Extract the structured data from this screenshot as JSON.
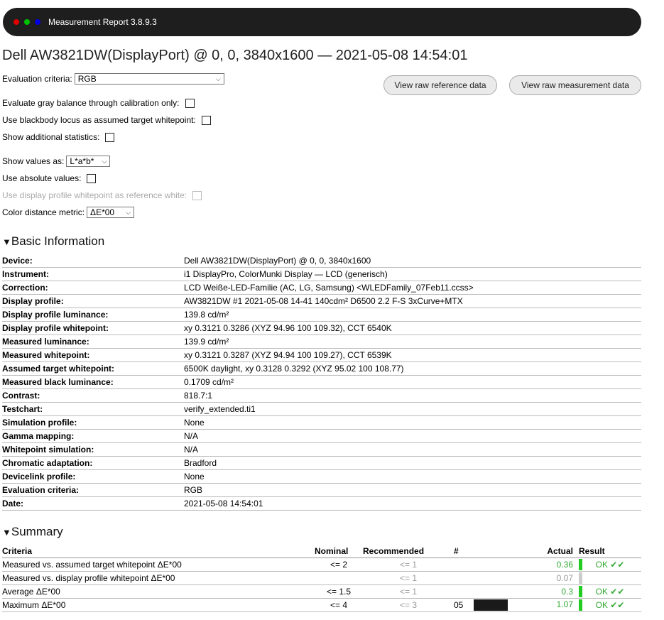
{
  "window": {
    "title": "Measurement Report 3.8.9.3",
    "dots": [
      "#e00000",
      "#00c000",
      "#0000e0"
    ]
  },
  "report_title": "Dell AW3821DW(DisplayPort) @ 0, 0, 3840x1600 — 2021-05-08 14:54:01",
  "controls": {
    "evaluation_criteria_label": "Evaluation criteria:",
    "evaluation_criteria_value": "RGB",
    "view_raw_reference": "View raw reference data",
    "view_raw_measurement": "View raw measurement data",
    "gray_balance_label": "Evaluate gray balance through calibration only:",
    "blackbody_label": "Use blackbody locus as assumed target whitepoint:",
    "additional_stats_label": "Show additional statistics:",
    "show_values_label": "Show values as:",
    "show_values_value": "L*a*b*",
    "absolute_values_label": "Use absolute values:",
    "profile_whitepoint_label": "Use display profile whitepoint as reference white:",
    "distance_metric_label": "Color distance metric:",
    "distance_metric_value": "ΔE*00"
  },
  "basic_info": {
    "heading": "Basic Information",
    "rows": [
      {
        "k": "Device:",
        "v": "Dell AW3821DW(DisplayPort) @ 0, 0, 3840x1600"
      },
      {
        "k": "Instrument:",
        "v": "i1 DisplayPro, ColorMunki Display — LCD (generisch)"
      },
      {
        "k": "Correction:",
        "v": "LCD Weiße-LED-Familie (AC, LG, Samsung) <WLEDFamily_07Feb11.ccss>"
      },
      {
        "k": "Display profile:",
        "v": "AW3821DW #1 2021-05-08 14-41 140cdm² D6500 2.2 F-S 3xCurve+MTX"
      },
      {
        "k": "Display profile luminance:",
        "v": "139.8 cd/m²"
      },
      {
        "k": "Display profile whitepoint:",
        "v": "xy 0.3121 0.3286 (XYZ 94.96 100 109.32), CCT 6540K"
      },
      {
        "k": "Measured luminance:",
        "v": "139.9 cd/m²"
      },
      {
        "k": "Measured whitepoint:",
        "v": "xy 0.3121 0.3287 (XYZ 94.94 100 109.27), CCT 6539K"
      },
      {
        "k": "Assumed target whitepoint:",
        "v": "6500K daylight, xy 0.3128 0.3292 (XYZ 95.02 100 108.77)"
      },
      {
        "k": "Measured black luminance:",
        "v": "0.1709 cd/m²"
      },
      {
        "k": "Contrast:",
        "v": "818.7:1"
      },
      {
        "k": "Testchart:",
        "v": "verify_extended.ti1"
      },
      {
        "k": "Simulation profile:",
        "v": "None"
      },
      {
        "k": "Gamma mapping:",
        "v": "N/A"
      },
      {
        "k": "Whitepoint simulation:",
        "v": "N/A"
      },
      {
        "k": "Chromatic adaptation:",
        "v": "Bradford"
      },
      {
        "k": "Devicelink profile:",
        "v": "None"
      },
      {
        "k": "Evaluation criteria:",
        "v": "RGB"
      },
      {
        "k": "Date:",
        "v": "2021-05-08 14:54:01"
      }
    ]
  },
  "summary": {
    "heading": "Summary",
    "headers": {
      "criteria": "Criteria",
      "nominal": "Nominal",
      "recommended": "Recommended",
      "num": "#",
      "actual": "Actual",
      "result": "Result"
    },
    "rows": [
      {
        "criteria": "Measured vs. assumed target whitepoint ΔE*00",
        "nominal": "<= 2",
        "recommended": "<= 1",
        "num": "",
        "actual": "0.36",
        "result": "OK ✔✔",
        "bar_color": "#22cc22"
      },
      {
        "criteria": "Measured vs. display profile whitepoint ΔE*00",
        "nominal": "",
        "recommended": "<= 1",
        "num": "",
        "actual": "0.07",
        "result": "",
        "bar_color": "#cccccc"
      },
      {
        "criteria": "Average ΔE*00",
        "nominal": "<= 1.5",
        "recommended": "<= 1",
        "num": "",
        "actual": "0.3",
        "result": "OK ✔✔",
        "bar_color": "#22cc22"
      },
      {
        "criteria": "Maximum ΔE*00",
        "nominal": "<= 4",
        "recommended": "<= 3",
        "num": "05",
        "actual": "1.07",
        "result": "OK ✔✔",
        "bar_color": "#22cc22"
      }
    ]
  }
}
